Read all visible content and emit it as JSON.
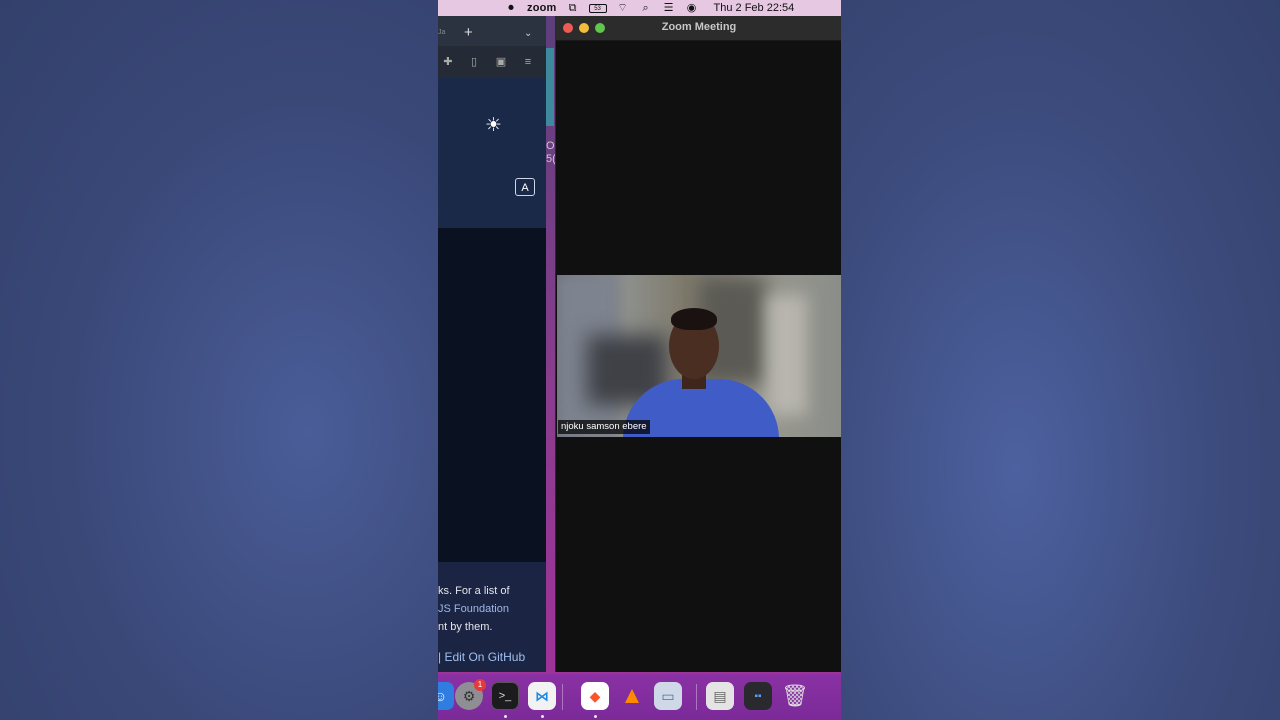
{
  "menubar": {
    "app_name": "zoom",
    "battery_level": "53",
    "datetime": "Thu 2 Feb  22:54"
  },
  "browser": {
    "tab_stub": "Ja",
    "new_tab": "+",
    "footer": {
      "line1": "ks. For a list of",
      "line2": "JS Foundation",
      "line3": "nt by them.",
      "edit_link": "| Edit On GitHub"
    },
    "strip_text_1": "O",
    "strip_text_2": "5("
  },
  "zoom": {
    "window_title": "Zoom Meeting",
    "participant_name": "njoku samson ebere"
  },
  "dock": {
    "settings_badge": "1"
  },
  "colors": {
    "menubar_bg": "#e7c8e3",
    "wallpaper": "#3a4a7a",
    "zoom_bg": "#101010",
    "dock_bg": "#8a31a4",
    "link": "#9fc0f0"
  }
}
